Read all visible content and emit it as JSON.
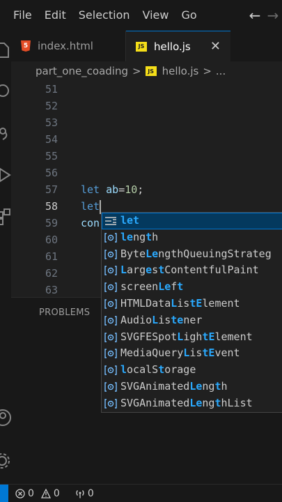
{
  "menubar": {
    "items": [
      "File",
      "Edit",
      "Selection",
      "View",
      "Go"
    ],
    "back_icon": "arrow-left-icon",
    "forward_icon": "arrow-right-icon"
  },
  "activitybar": {
    "icons": [
      "explorer-icon",
      "search-icon",
      "source-control-icon",
      "run-debug-icon",
      "extensions-icon",
      "account-icon",
      "settings-gear-icon"
    ]
  },
  "tabs": [
    {
      "label": "index.html",
      "icon": "html-file-icon",
      "icon_text": "5",
      "active": false
    },
    {
      "label": "hello.js",
      "icon": "js-file-icon",
      "icon_text": "JS",
      "active": true,
      "close": "✕"
    }
  ],
  "breadcrumb": {
    "folder": "part_one_coading",
    "file": "hello.js",
    "file_icon_text": "JS",
    "separator": ">",
    "more": "..."
  },
  "editor": {
    "lines": [
      {
        "number": "51",
        "code": ""
      },
      {
        "number": "52",
        "code": ""
      },
      {
        "number": "53",
        "code": ""
      },
      {
        "number": "54",
        "code": ""
      },
      {
        "number": "55",
        "code": ""
      },
      {
        "number": "56",
        "code": ""
      },
      {
        "number": "57",
        "code": "let ab=10;"
      },
      {
        "number": "58",
        "code": "let"
      },
      {
        "number": "59",
        "code": "con"
      },
      {
        "number": "60",
        "code": ""
      },
      {
        "number": "61",
        "code": ""
      },
      {
        "number": "62",
        "code": ""
      },
      {
        "number": "63",
        "code": ""
      }
    ],
    "current_line": "58"
  },
  "panel": {
    "tab": "PROBLEMS"
  },
  "suggest": {
    "items": [
      {
        "label": "let",
        "icon": "keyword-icon",
        "selected": true,
        "parts": [
          [
            "let",
            true
          ]
        ]
      },
      {
        "label": "length",
        "icon": "variable-icon",
        "parts": [
          [
            "le",
            true
          ],
          [
            "ng",
            false
          ],
          [
            "t",
            true
          ],
          [
            "h",
            false
          ]
        ]
      },
      {
        "label": "ByteLengthQueuingStrateg",
        "icon": "variable-icon",
        "parts": [
          [
            "Byte",
            false
          ],
          [
            "Le",
            true
          ],
          [
            "ngthQueuingStrateg",
            false
          ]
        ]
      },
      {
        "label": "LargestContentfulPaint",
        "icon": "variable-icon",
        "parts": [
          [
            "L",
            true
          ],
          [
            "arg",
            false
          ],
          [
            "e",
            true
          ],
          [
            "s",
            false
          ],
          [
            "t",
            true
          ],
          [
            "ContentfulPaint",
            false
          ]
        ]
      },
      {
        "label": "screenLeft",
        "icon": "variable-icon",
        "parts": [
          [
            "screen",
            false
          ],
          [
            "Le",
            true
          ],
          [
            "f",
            false
          ],
          [
            "t",
            true
          ]
        ]
      },
      {
        "label": "HTMLDataListElement",
        "icon": "variable-icon",
        "parts": [
          [
            "HTMLData",
            false
          ],
          [
            "L",
            true
          ],
          [
            "is",
            false
          ],
          [
            "t",
            true
          ],
          [
            "E",
            true
          ],
          [
            "lement",
            false
          ]
        ]
      },
      {
        "label": "AudioListener",
        "icon": "variable-icon",
        "parts": [
          [
            "Audio",
            false
          ],
          [
            "L",
            true
          ],
          [
            "is",
            false
          ],
          [
            "te",
            true
          ],
          [
            "ner",
            false
          ]
        ]
      },
      {
        "label": "SVGFESpotLightElement",
        "icon": "variable-icon",
        "parts": [
          [
            "SVGFESpot",
            false
          ],
          [
            "L",
            true
          ],
          [
            "igh",
            false
          ],
          [
            "t",
            true
          ],
          [
            "E",
            true
          ],
          [
            "lement",
            false
          ]
        ]
      },
      {
        "label": "MediaQueryListEvent",
        "icon": "variable-icon",
        "parts": [
          [
            "MediaQuery",
            false
          ],
          [
            "L",
            true
          ],
          [
            "is",
            false
          ],
          [
            "tE",
            true
          ],
          [
            "vent",
            false
          ]
        ]
      },
      {
        "label": "localStorage",
        "icon": "variable-icon",
        "parts": [
          [
            "l",
            true
          ],
          [
            "ocalS",
            false
          ],
          [
            "t",
            true
          ],
          [
            "orage",
            false
          ]
        ]
      },
      {
        "label": "SVGAnimatedLength",
        "icon": "variable-icon",
        "parts": [
          [
            "SVGAnimated",
            false
          ],
          [
            "Le",
            true
          ],
          [
            "ng",
            false
          ],
          [
            "t",
            true
          ],
          [
            "h",
            false
          ]
        ]
      },
      {
        "label": "SVGAnimatedLengthList",
        "icon": "variable-icon",
        "parts": [
          [
            "SVGAnimated",
            false
          ],
          [
            "Le",
            true
          ],
          [
            "ng",
            false
          ],
          [
            "t",
            true
          ],
          [
            "hList",
            false
          ]
        ]
      }
    ]
  },
  "statusbar": {
    "errors": "0",
    "warnings": "0",
    "ports": "0"
  },
  "colors": {
    "accent": "#0078d4",
    "keyword": "#569cd6",
    "variable": "#9cdcfe",
    "number": "#b5cea8",
    "match_highlight": "#2aaaff"
  }
}
